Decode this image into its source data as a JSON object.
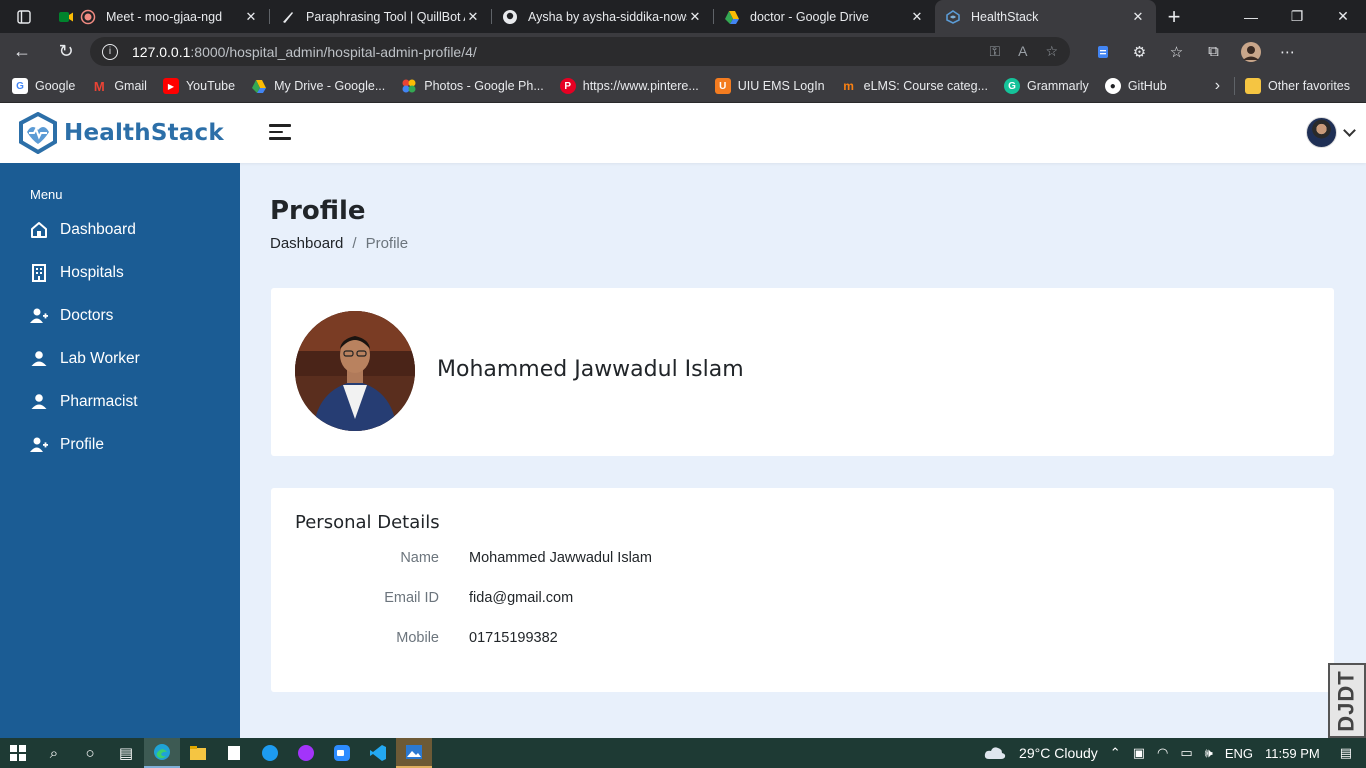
{
  "browser": {
    "tabs": [
      {
        "title": "Meet - moo-gjaa-ngd",
        "icon": "google-meet-icon",
        "active": false
      },
      {
        "title": "Paraphrasing Tool | QuillBot A",
        "icon": "quillbot-icon",
        "active": false
      },
      {
        "title": "Aysha by aysha-siddika-nows",
        "icon": "github-icon",
        "active": false
      },
      {
        "title": "doctor - Google Drive",
        "icon": "google-drive-icon",
        "active": false
      },
      {
        "title": "HealthStack",
        "icon": "healthstack-icon",
        "active": true
      }
    ],
    "url_host": "127.0.0.1",
    "url_path": ":8000/hospital_admin/hospital-admin-profile/4/",
    "bookmarks": [
      {
        "label": "Google",
        "icon": "google-icon",
        "color": "#ffffff"
      },
      {
        "label": "Gmail",
        "icon": "gmail-icon",
        "color": "#ea4335"
      },
      {
        "label": "YouTube",
        "icon": "youtube-icon",
        "color": "#ff0000"
      },
      {
        "label": "My Drive - Google...",
        "icon": "google-drive-icon",
        "color": "#fbbc04"
      },
      {
        "label": "Photos - Google Ph...",
        "icon": "google-photos-icon",
        "color": "#34a853"
      },
      {
        "label": "https://www.pintere...",
        "icon": "pinterest-icon",
        "color": "#e60023"
      },
      {
        "label": "UIU EMS LogIn",
        "icon": "uiu-icon",
        "color": "#f47c20"
      },
      {
        "label": "eLMS: Course categ...",
        "icon": "moodle-icon",
        "color": "#f98012"
      },
      {
        "label": "Grammarly",
        "icon": "grammarly-icon",
        "color": "#15c39a"
      },
      {
        "label": "GitHub",
        "icon": "github-icon",
        "color": "#ffffff"
      }
    ],
    "other_favorites": "Other favorites"
  },
  "app": {
    "brand": "HealthStack",
    "brand_color": "#2c6fa8",
    "sidebar_color": "#1b5c94",
    "menu_heading": "Menu",
    "sidebar_items": [
      {
        "label": "Dashboard",
        "icon": "home-icon"
      },
      {
        "label": "Hospitals",
        "icon": "building-icon"
      },
      {
        "label": "Doctors",
        "icon": "user-plus-icon"
      },
      {
        "label": "Lab Worker",
        "icon": "user-icon"
      },
      {
        "label": "Pharmacist",
        "icon": "user-icon"
      },
      {
        "label": "Profile",
        "icon": "user-plus-icon"
      }
    ],
    "page_title": "Profile",
    "breadcrumb": {
      "home": "Dashboard",
      "current": "Profile"
    },
    "profile": {
      "name": "Mohammed Jawwadul Islam"
    },
    "personal_details": {
      "title": "Personal Details",
      "rows": [
        {
          "label": "Name",
          "value": "Mohammed Jawwadul Islam"
        },
        {
          "label": "Email ID",
          "value": "fida@gmail.com"
        },
        {
          "label": "Mobile",
          "value": "01715199382"
        }
      ]
    }
  },
  "watermark": "DJDT",
  "taskbar": {
    "weather": "29°C  Cloudy",
    "language": "ENG",
    "time": "11:59 PM"
  }
}
